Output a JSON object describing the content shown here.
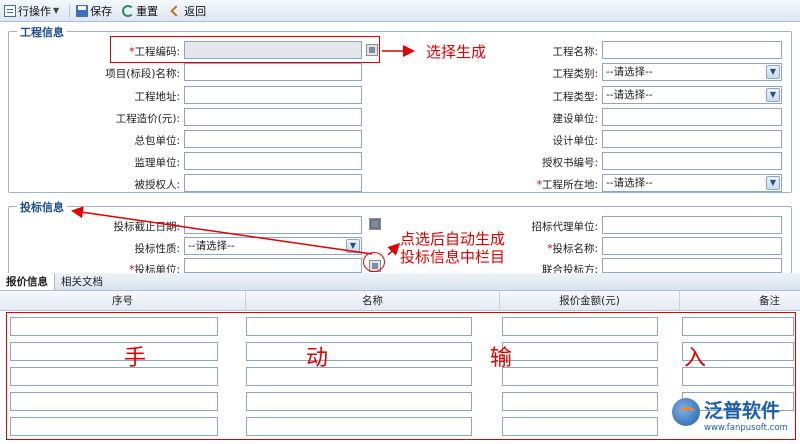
{
  "toolbar": {
    "row_ops": "行操作",
    "save": "保存",
    "reset": "重置",
    "back": "返回"
  },
  "project_section": {
    "legend": "工程信息",
    "left_fields": [
      {
        "label": "工程编码:",
        "required": true,
        "kind": "readonly-pick"
      },
      {
        "label": "项目(标段)名称:",
        "required": false,
        "kind": "text"
      },
      {
        "label": "工程地址:",
        "required": false,
        "kind": "text"
      },
      {
        "label": "工程造价(元):",
        "required": false,
        "kind": "text"
      },
      {
        "label": "总包单位:",
        "required": false,
        "kind": "text"
      },
      {
        "label": "监理单位:",
        "required": false,
        "kind": "text"
      },
      {
        "label": "被授权人:",
        "required": false,
        "kind": "text"
      }
    ],
    "right_fields": [
      {
        "label": "工程名称:",
        "required": false,
        "kind": "text",
        "value": ""
      },
      {
        "label": "工程类别:",
        "required": false,
        "kind": "select",
        "value": "--请选择--"
      },
      {
        "label": "工程类型:",
        "required": false,
        "kind": "select",
        "value": "--请选择--"
      },
      {
        "label": "建设单位:",
        "required": false,
        "kind": "text",
        "value": ""
      },
      {
        "label": "设计单位:",
        "required": false,
        "kind": "text",
        "value": ""
      },
      {
        "label": "授权书编号:",
        "required": false,
        "kind": "text",
        "value": ""
      },
      {
        "label": "工程所在地:",
        "required": true,
        "kind": "select",
        "value": "--请选择--"
      }
    ]
  },
  "bid_section": {
    "legend": "投标信息",
    "left_fields": [
      {
        "label": "投标截止日期:",
        "required": false,
        "kind": "date"
      },
      {
        "label": "投标性质:",
        "required": false,
        "kind": "select",
        "value": "--请选择--"
      },
      {
        "label": "投标单位:",
        "required": true,
        "kind": "pick"
      }
    ],
    "right_fields": [
      {
        "label": "招标代理单位:",
        "required": false
      },
      {
        "label": "投标名称:",
        "required": true
      },
      {
        "label": "联合投标方:",
        "required": false
      }
    ]
  },
  "tabs": [
    {
      "label": "报价信息",
      "active": true
    },
    {
      "label": "相关文档",
      "active": false
    }
  ],
  "grid": {
    "headers": [
      "序号",
      "名称",
      "报价金额(元)",
      "备注"
    ],
    "row_count": 5
  },
  "annotations": {
    "select_generate": "选择生成",
    "auto_generate_line1": "点选后自动生成",
    "auto_generate_line2": "投标信息中栏目",
    "manual_chars": [
      "手",
      "动",
      "输",
      "入"
    ],
    "color": "#e00000"
  },
  "logo": {
    "name": "泛普软件",
    "url": "www.fanpusoft.com"
  }
}
